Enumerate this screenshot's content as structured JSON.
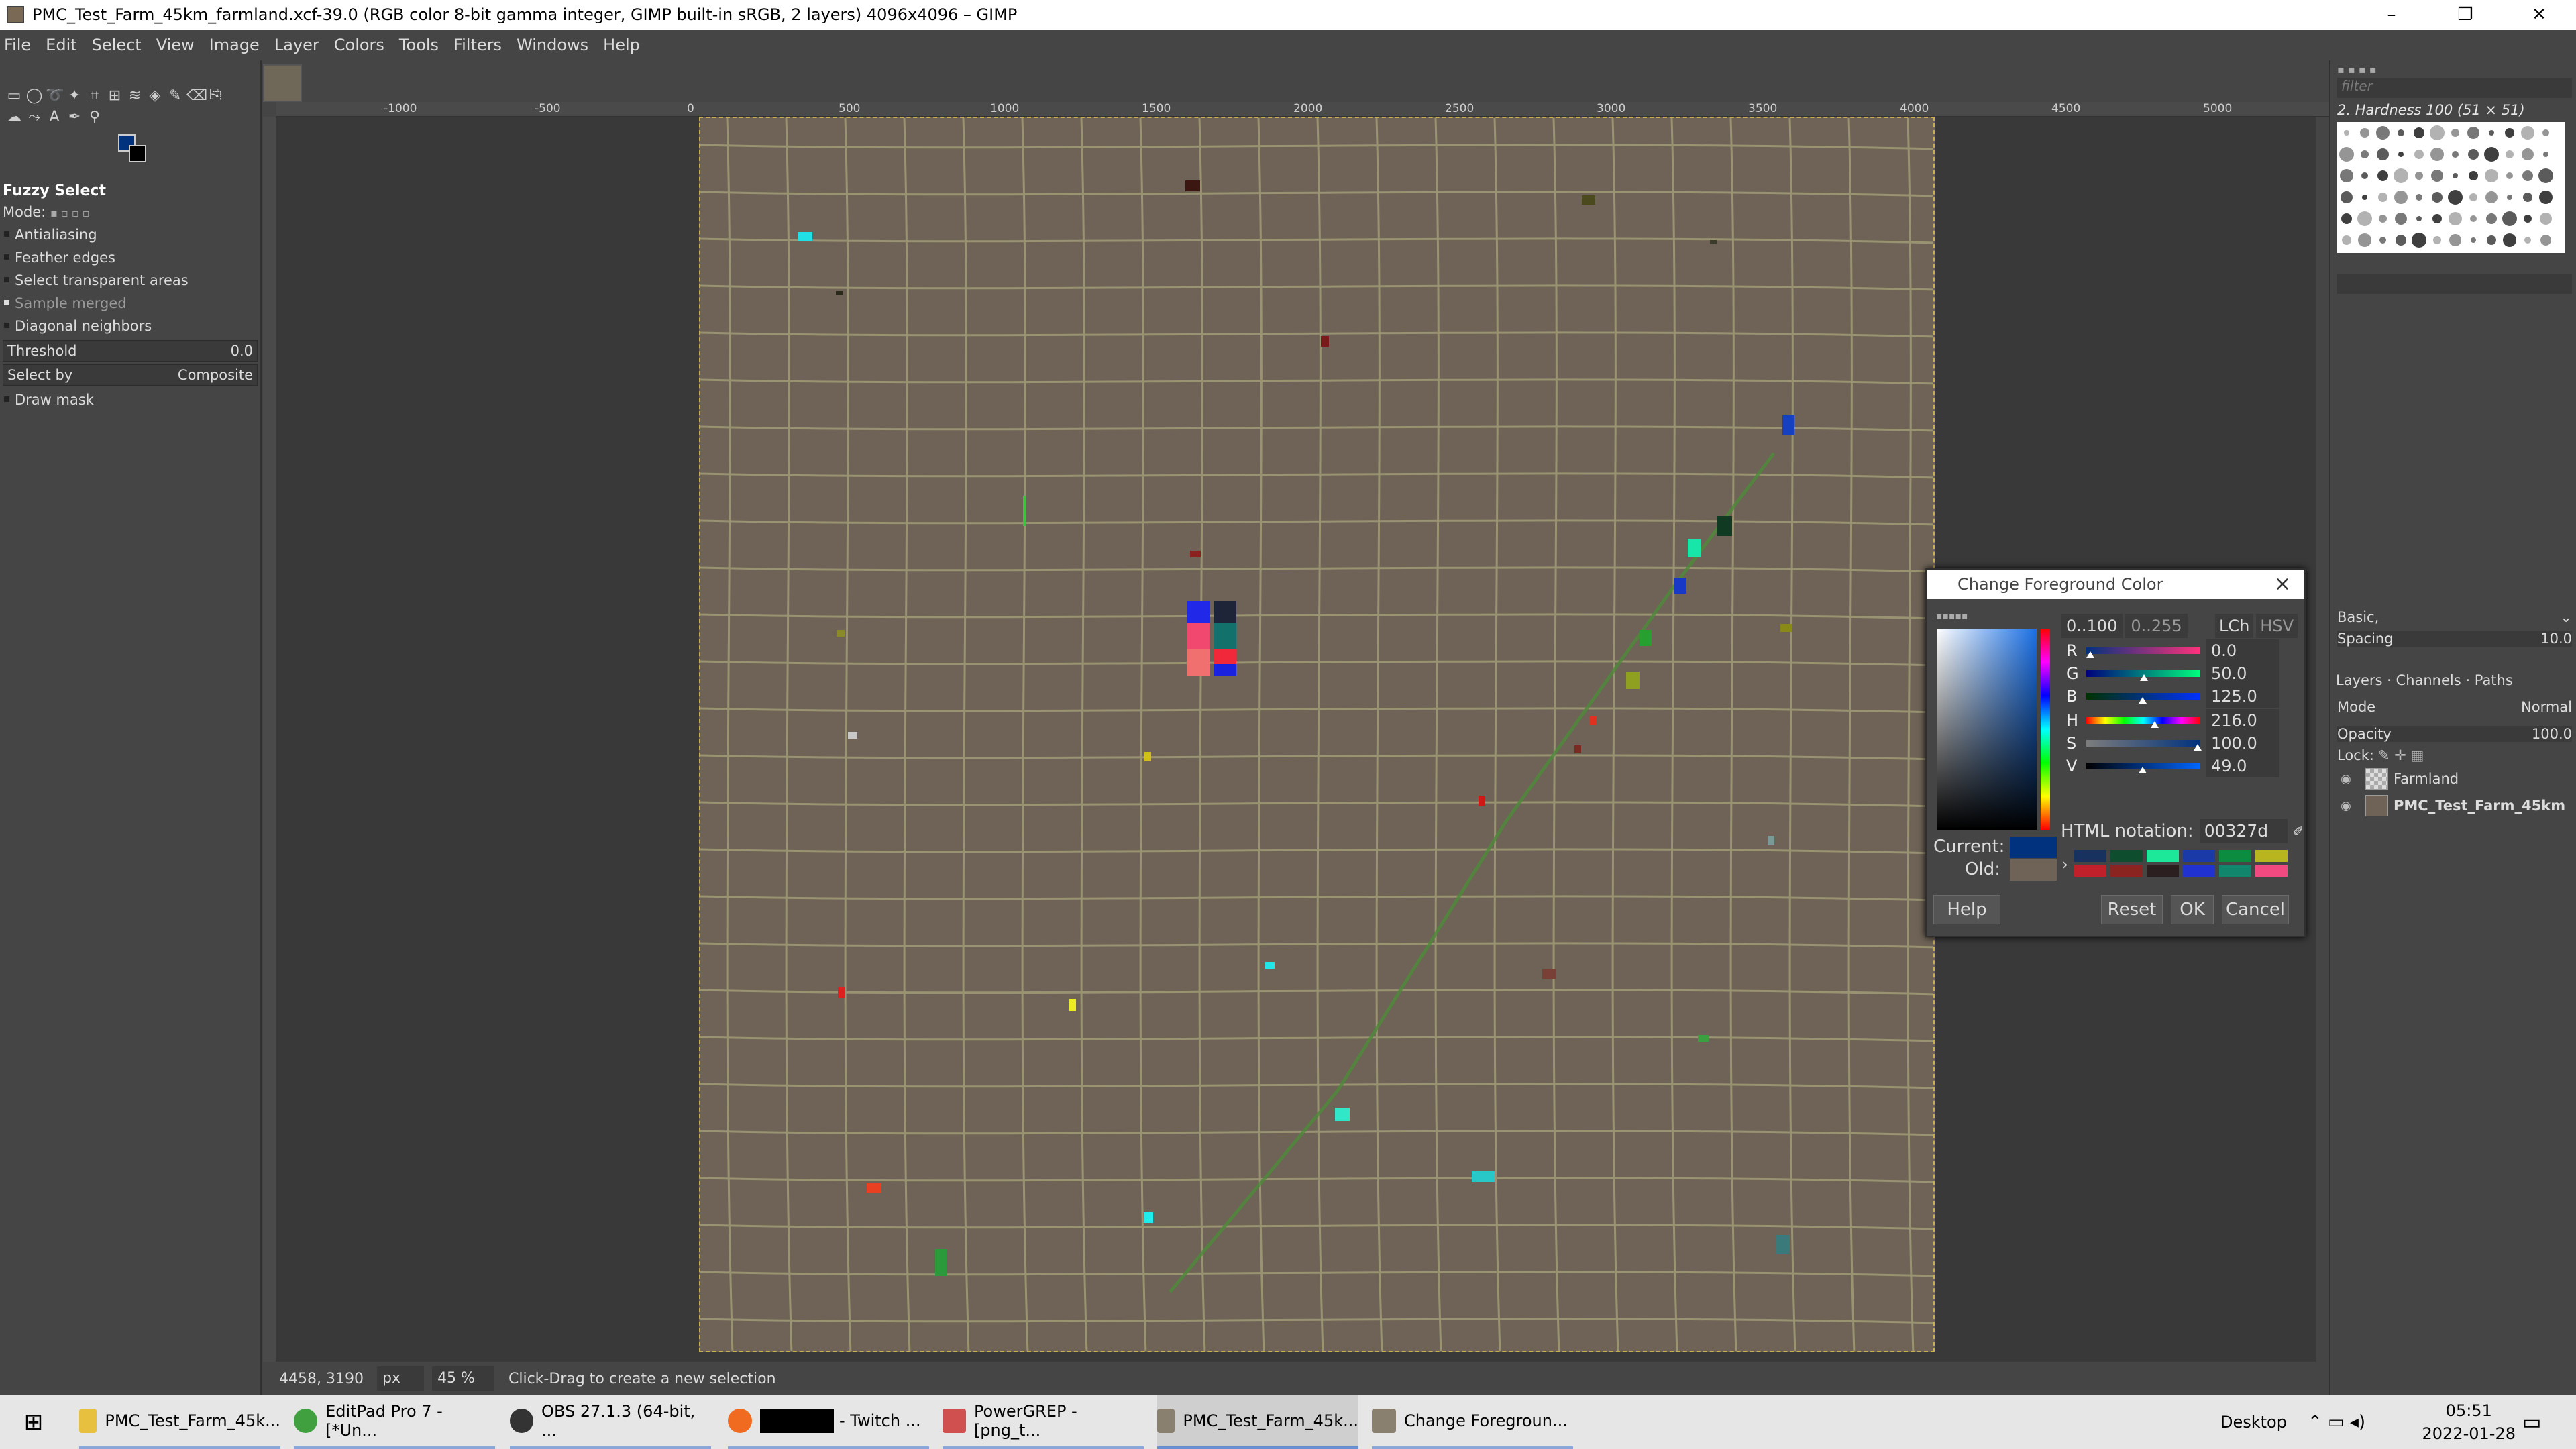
{
  "window": {
    "title": "PMC_Test_Farm_45km_farmland.xcf-39.0 (RGB color 8-bit gamma integer, GIMP built-in sRGB, 2 layers) 4096x4096 – GIMP",
    "minimize": "–",
    "maximize": "❐",
    "close": "✕"
  },
  "menu": [
    "File",
    "Edit",
    "Select",
    "View",
    "Image",
    "Layer",
    "Colors",
    "Tools",
    "Filters",
    "Windows",
    "Help"
  ],
  "tool_options": {
    "title": "Fuzzy Select",
    "mode_label": "Mode:",
    "antialiasing": "Antialiasing",
    "feather": "Feather edges",
    "transparent": "Select transparent areas",
    "sample_merged": "Sample merged",
    "diagonal": "Diagonal neighbors",
    "threshold_label": "Threshold",
    "threshold_value": "0.0",
    "select_by_label": "Select by",
    "select_by_value": "Composite",
    "draw_mask": "Draw mask"
  },
  "ruler_labels": [
    "-1000",
    "-500",
    "0",
    "500",
    "1000",
    "1500",
    "2000",
    "2500",
    "3000",
    "3500",
    "4000",
    "4500",
    "5000"
  ],
  "status": {
    "coords": "4458, 3190",
    "unit": "px",
    "zoom": "45 %",
    "message": "Click-Drag to create a new selection"
  },
  "brushes": {
    "filter_placeholder": "filter",
    "current": "2. Hardness 100 (51 × 51)",
    "preset": "Basic,",
    "spacing_label": "Spacing",
    "spacing_value": "10.0"
  },
  "layers_panel": {
    "tabs": [
      "Layers",
      "Channels",
      "Paths"
    ],
    "mode_label": "Mode",
    "mode_value": "Normal",
    "opacity_label": "Opacity",
    "opacity_value": "100.0",
    "lock_label": "Lock:",
    "layers": [
      {
        "name": "Farmland",
        "bold": false
      },
      {
        "name": "PMC_Test_Farm_45km",
        "bold": true
      }
    ]
  },
  "color_dialog": {
    "title": "Change Foreground Color",
    "range_100": "0..100",
    "range_255": "0..255",
    "mode_lch": "LCh",
    "mode_hsv": "HSV",
    "channels": [
      {
        "label": "R",
        "value": "0.0",
        "pos": 0.0
      },
      {
        "label": "G",
        "value": "50.0",
        "pos": 0.5
      },
      {
        "label": "B",
        "value": "125.0",
        "pos": 0.49
      },
      {
        "label": "H",
        "value": "216.0",
        "pos": 0.6
      },
      {
        "label": "S",
        "value": "100.0",
        "pos": 1.0
      },
      {
        "label": "V",
        "value": "49.0",
        "pos": 0.49
      }
    ],
    "html_label": "HTML notation:",
    "html_value": "00327d",
    "current_label": "Current:",
    "old_label": "Old:",
    "current_color": "#00327d",
    "old_color": "#6e6356",
    "history_colors": [
      "#17325e",
      "#0e4d2e",
      "#1de89a",
      "#1a3aa8",
      "#0c8c3e",
      "#b9b51e",
      "#c0202a",
      "#8a2420",
      "#2b1f1f",
      "#2033d0",
      "#12866c",
      "#f04a80"
    ],
    "help": "Help",
    "reset": "Reset",
    "ok": "OK",
    "cancel": "Cancel"
  },
  "taskbar": {
    "items": [
      "PMC_Test_Farm_45k...",
      "EditPad Pro 7 - [*Un...",
      "OBS 27.1.3 (64-bit, ...",
      "- Twitch ...",
      "PowerGREP - [png_t...",
      "PMC_Test_Farm_45k...",
      "Change Foregroun..."
    ],
    "desktop": "Desktop",
    "time": "05:51",
    "date": "2022-01-28"
  }
}
